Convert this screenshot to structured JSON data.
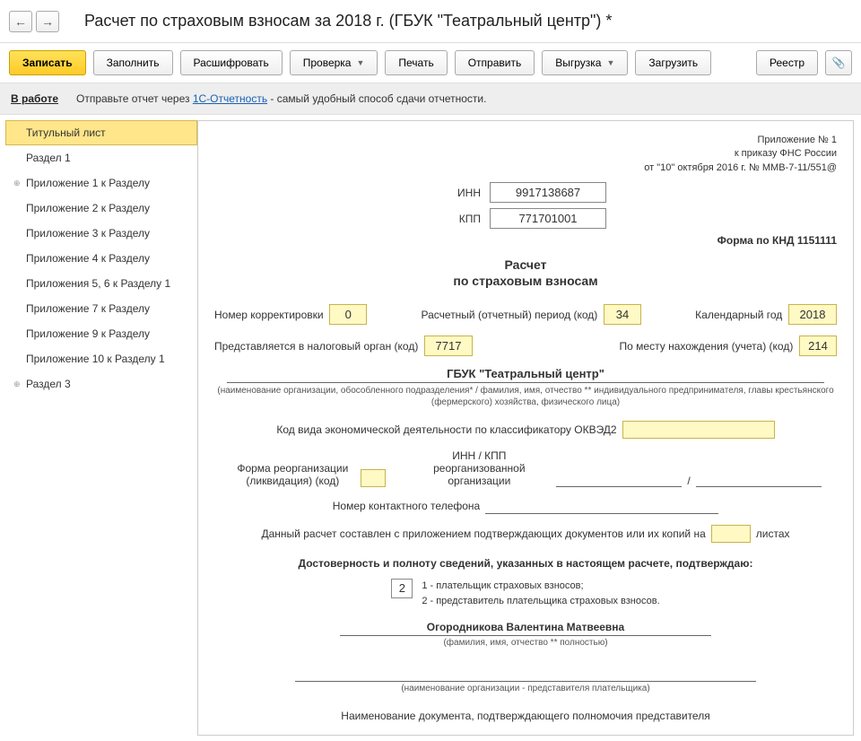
{
  "header": {
    "page_title": "Расчет по страховым взносам за 2018 г. (ГБУК \"Театральный центр\") *"
  },
  "toolbar": {
    "write": "Записать",
    "fill": "Заполнить",
    "decode": "Расшифровать",
    "check": "Проверка",
    "print": "Печать",
    "send": "Отправить",
    "upload": "Выгрузка",
    "download": "Загрузить",
    "registry": "Реестр"
  },
  "infobar": {
    "status": "В работе",
    "text_before": "Отправьте отчет через ",
    "link": "1С-Отчетность",
    "text_after": " - самый удобный способ сдачи отчетности."
  },
  "sidebar": {
    "items": [
      {
        "label": "Титульный лист",
        "active": true,
        "expandable": false
      },
      {
        "label": "Раздел 1",
        "active": false,
        "expandable": false
      },
      {
        "label": "Приложение 1 к Разделу",
        "active": false,
        "expandable": true
      },
      {
        "label": "Приложение 2 к Разделу",
        "active": false,
        "expandable": false
      },
      {
        "label": "Приложение 3 к Разделу",
        "active": false,
        "expandable": false
      },
      {
        "label": "Приложение 4 к Разделу",
        "active": false,
        "expandable": false
      },
      {
        "label": "Приложения 5, 6 к Разделу 1",
        "active": false,
        "expandable": false
      },
      {
        "label": "Приложение 7 к Разделу",
        "active": false,
        "expandable": false
      },
      {
        "label": "Приложение 9 к Разделу",
        "active": false,
        "expandable": false
      },
      {
        "label": "Приложение 10 к Разделу 1",
        "active": false,
        "expandable": false
      },
      {
        "label": "Раздел 3",
        "active": false,
        "expandable": true
      }
    ]
  },
  "form": {
    "meta_line1": "Приложение № 1",
    "meta_line2": "к приказу ФНС России",
    "meta_line3": "от \"10\" октября 2016 г. № ММВ-7-11/551@",
    "inn_label": "ИНН",
    "inn": "9917138687",
    "kpp_label": "КПП",
    "kpp": "771701001",
    "knd": "Форма по КНД 1151111",
    "title": "Расчет",
    "subtitle": "по страховым взносам",
    "correction_label": "Номер корректировки",
    "correction": "0",
    "period_label": "Расчетный (отчетный) период (код)",
    "period": "34",
    "year_label": "Календарный год",
    "year": "2018",
    "tax_org_label": "Представляется в налоговый орган (код)",
    "tax_org": "7717",
    "location_label": "По месту нахождения (учета) (код)",
    "location": "214",
    "org_name": "ГБУК \"Театральный центр\"",
    "org_hint": "(наименование организации, обособленного подразделения* / фамилия, имя, отчество ** индивидуального предпринимателя, главы крестьянского (фермерского) хозяйства, физического лица)",
    "okved_label": "Код вида экономической деятельности по классификатору ОКВЭД2",
    "reorg_label": "Форма реорганизации (ликвидация) (код)",
    "reorg_inn_label": "ИНН / КПП реорганизованной организации",
    "slash": "/",
    "phone_label": "Номер контактного телефона",
    "docs_label_before": "Данный расчет составлен с приложением подтверждающих документов или их копий на",
    "docs_label_after": "листах",
    "confirm_heading": "Достоверность и полноту сведений, указанных в настоящем расчете, подтверждаю:",
    "confirm_code": "2",
    "confirm_text1": "1 - плательщик страховых взносов;",
    "confirm_text2": "2 - представитель плательщика страховых взносов.",
    "fio": "Огородникова Валентина Матвеевна",
    "fio_hint": "(фамилия, имя, отчество ** полностью)",
    "rep_hint": "(наименование организации - представителя плательщика)",
    "bottom": "Наименование документа, подтверждающего полномочия представителя"
  }
}
